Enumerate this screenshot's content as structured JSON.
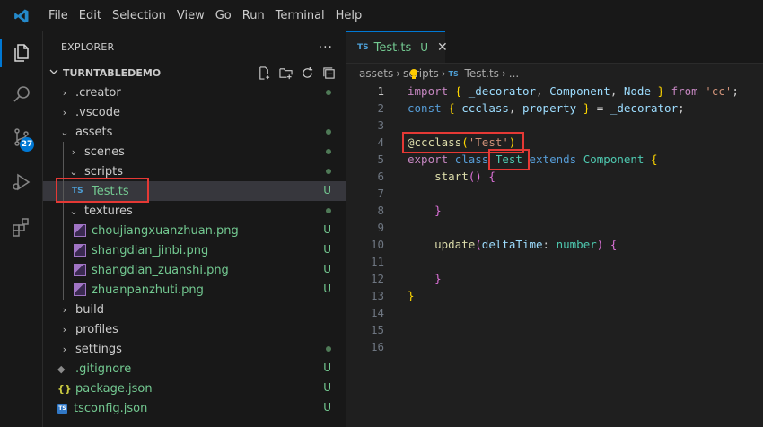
{
  "menu": [
    "File",
    "Edit",
    "Selection",
    "View",
    "Go",
    "Run",
    "Terminal",
    "Help"
  ],
  "activity": {
    "scm_badge": "27"
  },
  "explorer": {
    "title": "EXPLORER",
    "more": "···",
    "project": "TURNTABLEDEMO",
    "items": [
      {
        "label": ".creator"
      },
      {
        "label": ".vscode"
      },
      {
        "label": "assets"
      },
      {
        "label": "scenes"
      },
      {
        "label": "scripts"
      },
      {
        "label": "Test.ts",
        "status": "U"
      },
      {
        "label": "textures"
      },
      {
        "label": "choujiangxuanzhuan.png",
        "status": "U"
      },
      {
        "label": "shangdian_jinbi.png",
        "status": "U"
      },
      {
        "label": "shangdian_zuanshi.png",
        "status": "U"
      },
      {
        "label": "zhuanpanzhuti.png",
        "status": "U"
      },
      {
        "label": "build"
      },
      {
        "label": "profiles"
      },
      {
        "label": "settings"
      },
      {
        "label": ".gitignore",
        "status": "U"
      },
      {
        "label": "package.json",
        "status": "U"
      },
      {
        "label": "tsconfig.json",
        "status": "U"
      }
    ]
  },
  "editor": {
    "tab": {
      "badge": "TS",
      "name": "Test.ts",
      "status": "U",
      "close": "✕"
    },
    "breadcrumb": {
      "parts": [
        "assets",
        "scripts"
      ],
      "file": "Test.ts",
      "more": "..."
    },
    "line_numbers": [
      "1",
      "2",
      "3",
      "4",
      "5",
      "6",
      "7",
      "8",
      "9",
      "10",
      "11",
      "12",
      "13",
      "14",
      "15",
      "16"
    ]
  },
  "colors": {
    "accent": "#0078d4",
    "untracked": "#73c991",
    "highlight": "#e53935"
  }
}
